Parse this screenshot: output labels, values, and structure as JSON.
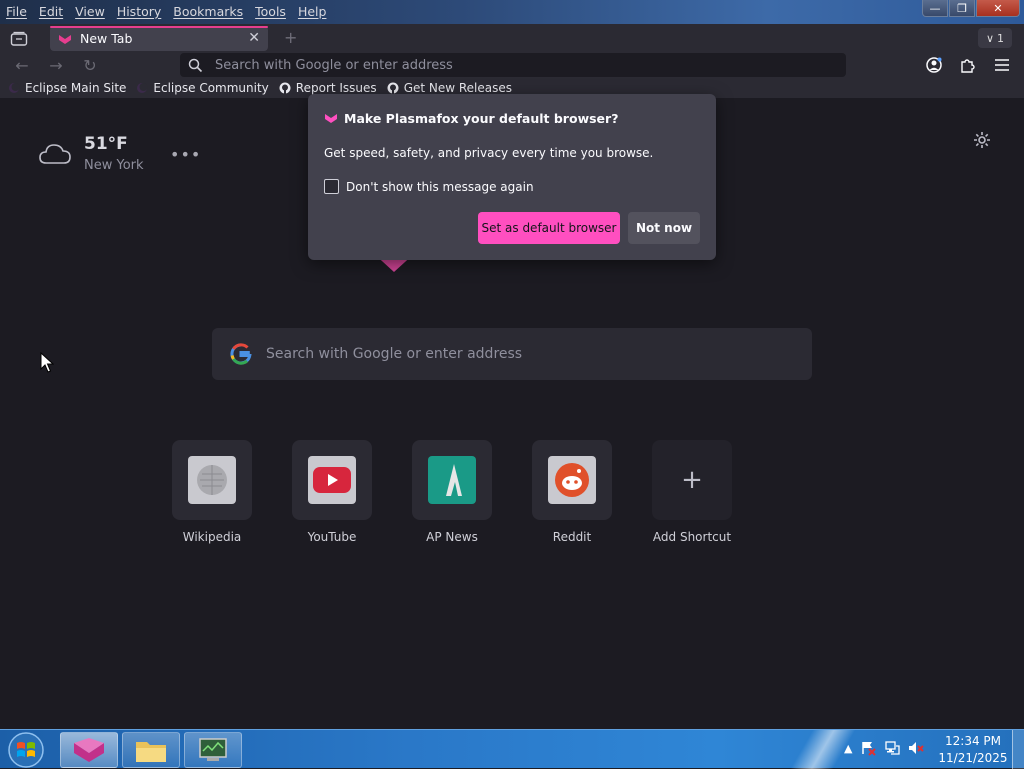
{
  "menu": [
    "File",
    "Edit",
    "View",
    "History",
    "Bookmarks",
    "Tools",
    "Help"
  ],
  "tab": {
    "title": "New Tab",
    "count": "1"
  },
  "urlbar": {
    "placeholder": "Search with Google or enter address"
  },
  "bookmarks": [
    {
      "label": "Eclipse Main Site",
      "icon": "eclipse-icon"
    },
    {
      "label": "Eclipse Community",
      "icon": "eclipse-icon"
    },
    {
      "label": "Report Issues",
      "icon": "github-icon"
    },
    {
      "label": "Get New Releases",
      "icon": "github-icon"
    }
  ],
  "weather": {
    "temp": "51°F",
    "city": "New York",
    "icon": "cloud-icon"
  },
  "popup": {
    "title": "Make Plasmafox your default browser?",
    "body": "Get speed, safety, and privacy every time you browse.",
    "checkbox": "Don't show this message again",
    "primary": "Set as default browser",
    "secondary": "Not now"
  },
  "search": {
    "placeholder": "Search with Google or enter address"
  },
  "shortcuts": [
    {
      "label": "Wikipedia",
      "icon": "wikipedia-icon"
    },
    {
      "label": "YouTube",
      "icon": "youtube-icon"
    },
    {
      "label": "AP News",
      "icon": "apnews-icon"
    },
    {
      "label": "Reddit",
      "icon": "reddit-icon"
    },
    {
      "label": "Add Shortcut",
      "icon": "plus-icon"
    }
  ],
  "clock": {
    "time": "12:34 PM",
    "date": "11/21/2025"
  },
  "colors": {
    "accent": "#ff4fc0",
    "tab_accent": "#e63e8f",
    "background": "#1c1b22",
    "toolbar": "#2b2a33"
  }
}
